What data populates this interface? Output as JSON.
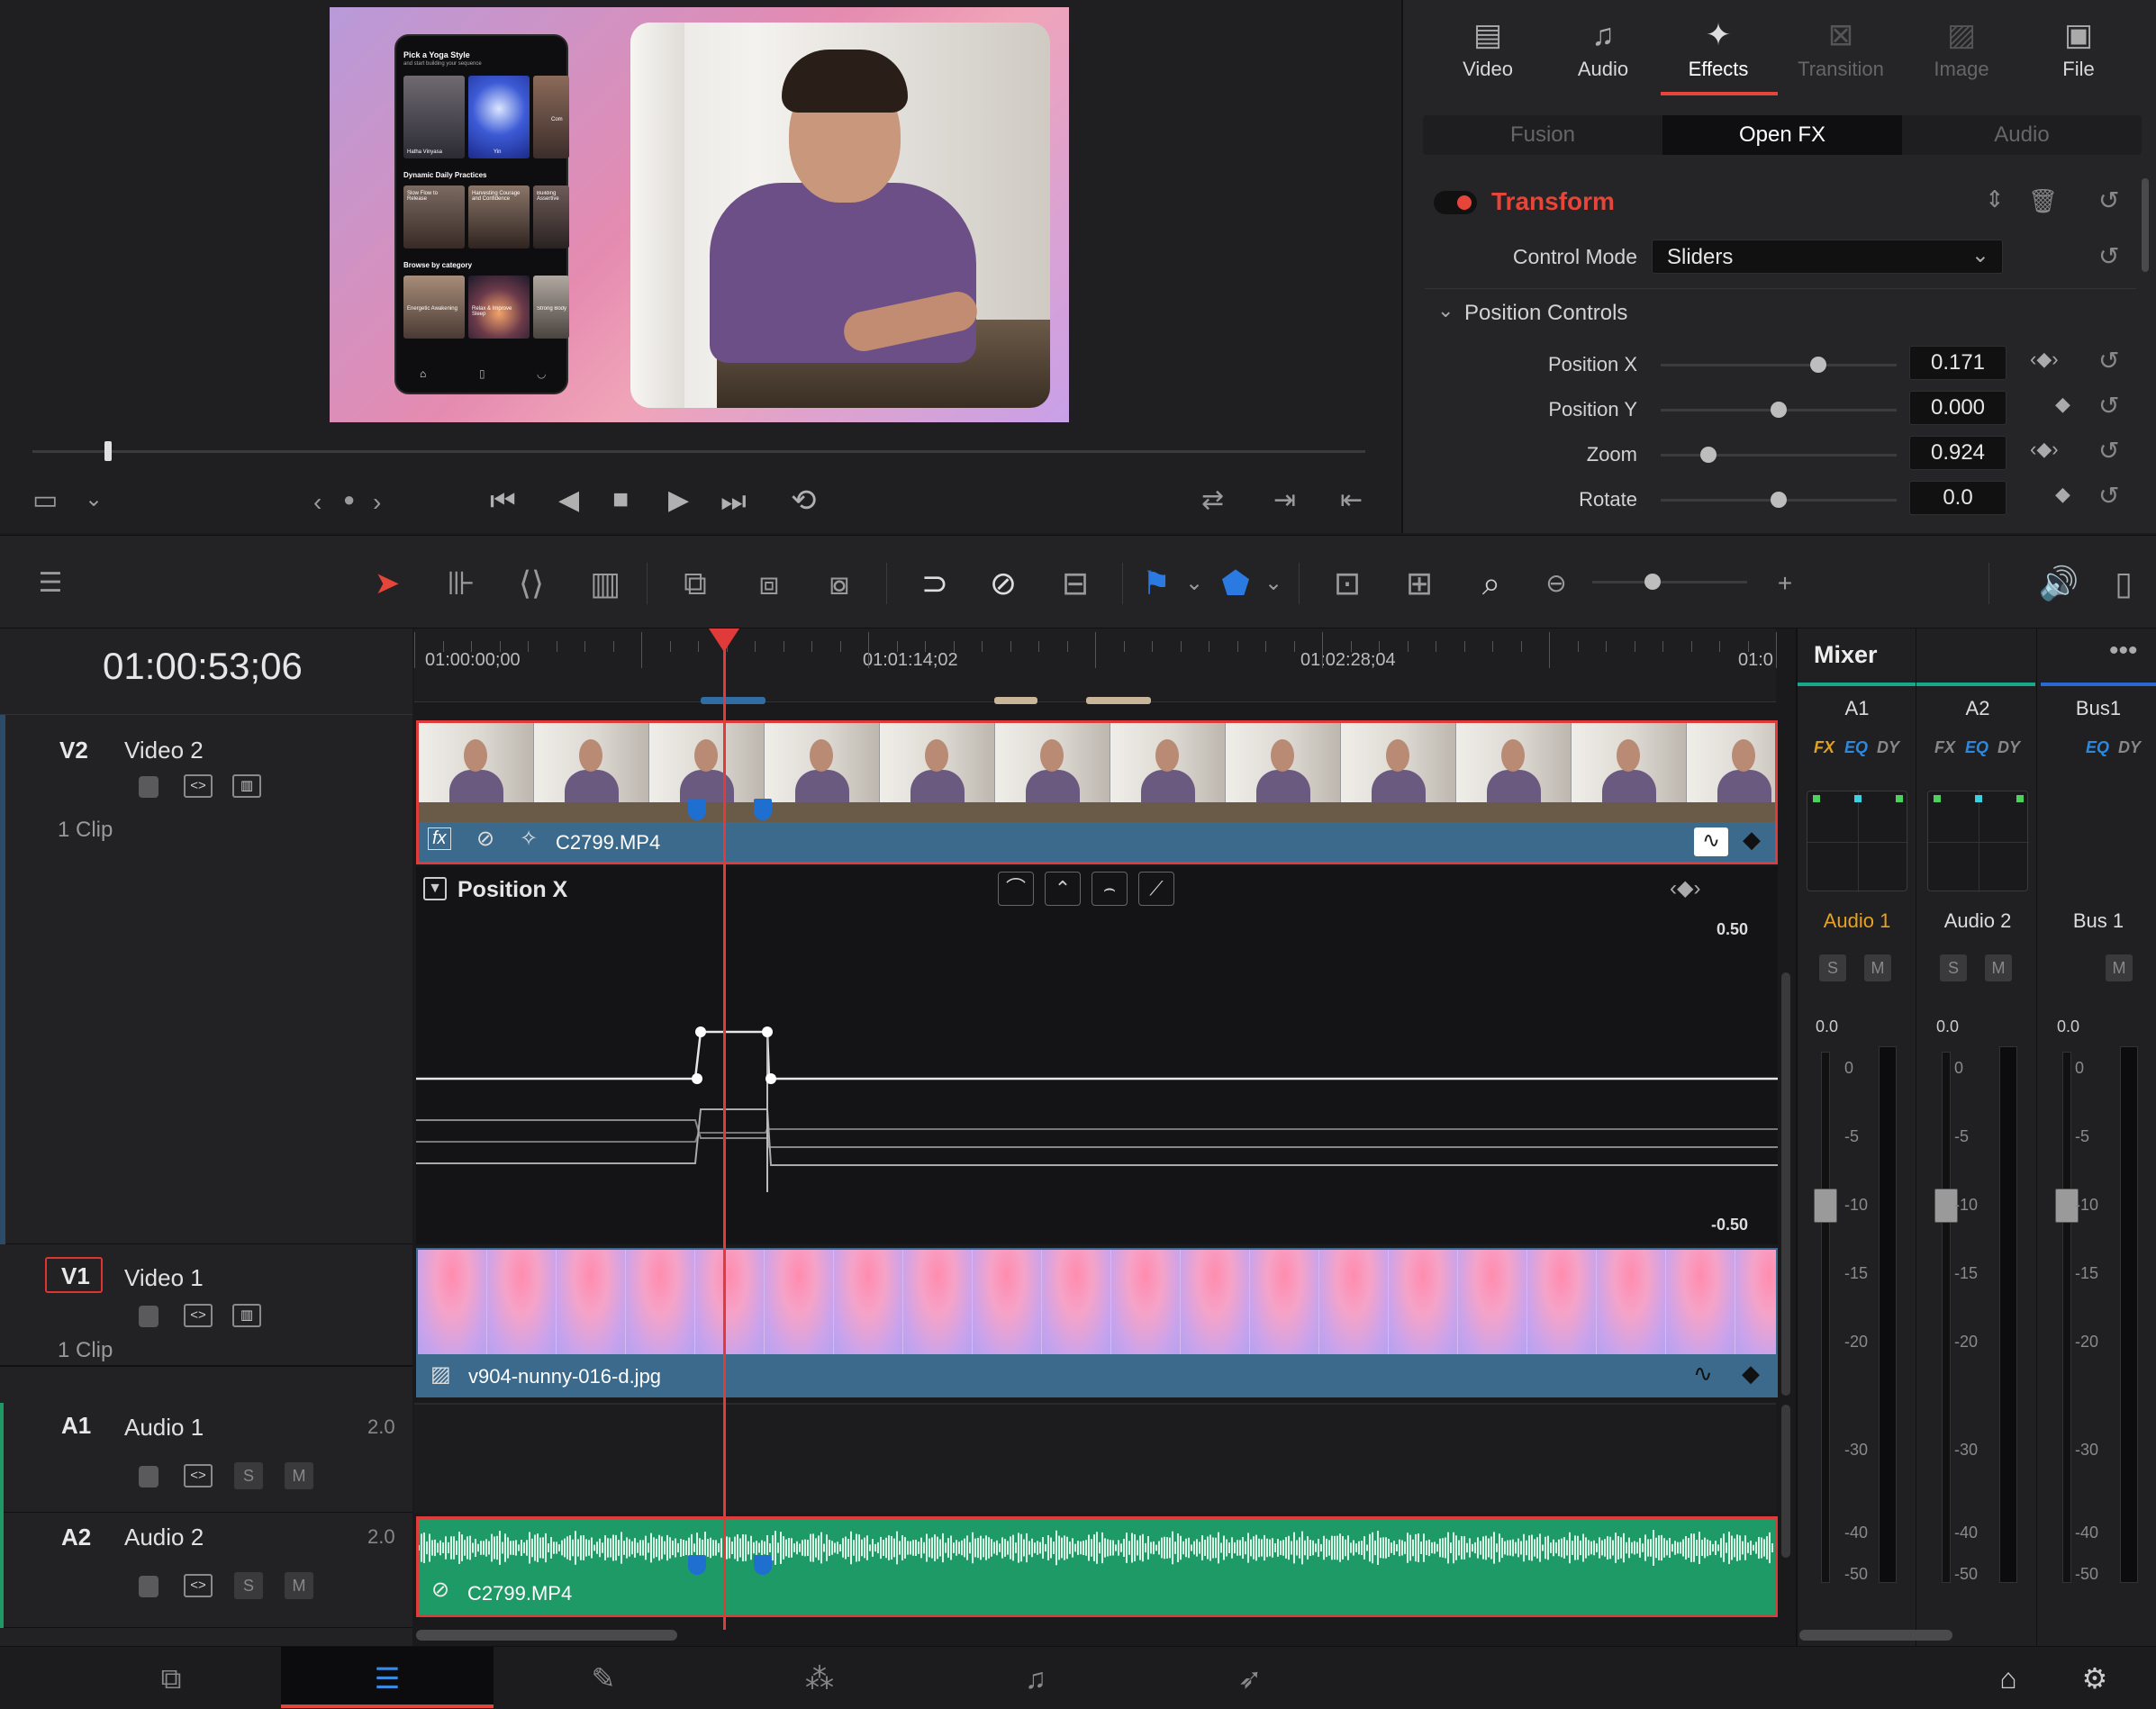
{
  "inspector": {
    "tabs": [
      {
        "label": "Video",
        "icon": "film-icon",
        "state": "normal"
      },
      {
        "label": "Audio",
        "icon": "music-note-icon",
        "state": "normal"
      },
      {
        "label": "Effects",
        "icon": "magic-wand-icon",
        "state": "active"
      },
      {
        "label": "Transition",
        "icon": "transition-icon",
        "state": "disabled"
      },
      {
        "label": "Image",
        "icon": "image-icon",
        "state": "disabled"
      },
      {
        "label": "File",
        "icon": "file-icon",
        "state": "normal"
      }
    ],
    "subtabs": [
      "Fusion",
      "Open FX",
      "Audio"
    ],
    "section_title": "Transform",
    "control_mode_label": "Control Mode",
    "control_mode_value": "Sliders",
    "group_title": "Position Controls",
    "params": [
      {
        "label": "Position X",
        "value": "0.171",
        "slider": 0.68
      },
      {
        "label": "Position Y",
        "value": "0.000",
        "slider": 0.5
      },
      {
        "label": "Zoom",
        "value": "0.924",
        "slider": 0.18
      },
      {
        "label": "Rotate",
        "value": "0.0",
        "slider": 0.5
      }
    ]
  },
  "preview": {
    "phone": {
      "heading": "Pick a Yoga Style",
      "subheading": "and start building your sequence",
      "style_captions": [
        "Hatha Vinyasa",
        "Yin",
        "Com"
      ],
      "section1": "Dynamic Daily Practices",
      "practice_captions": [
        "Slow Flow to Release",
        "Harvesting Courage and Confidence",
        "Building Assertive"
      ],
      "section2": "Browse by category",
      "category_captions": [
        "Energetic Awakening",
        "Relax & Improve Sleep",
        "Strong Body"
      ]
    }
  },
  "timeline": {
    "timecode": "01:00:53;06",
    "ruler_labels": [
      "01:00:00;00",
      "01:01:14;02",
      "01:02:28;04",
      "01:0"
    ],
    "playhead_fraction": 0.227,
    "tracks": {
      "v2": {
        "id": "V2",
        "name": "Video 2",
        "clips": "1 Clip",
        "clip_name": "C2799.MP4"
      },
      "v1": {
        "id": "V1",
        "name": "Video 1",
        "clips": "1 Clip",
        "clip_name": "v904-nunny-016-d.jpg"
      },
      "a1": {
        "id": "A1",
        "name": "Audio 1",
        "channels": "2.0"
      },
      "a2": {
        "id": "A2",
        "name": "Audio 2",
        "channels": "2.0",
        "clip_name": "C2799.MP4"
      }
    },
    "keyframe_editor": {
      "param": "Position X",
      "max": "0.50",
      "min": "-0.50"
    },
    "solo": "S",
    "mute": "M"
  },
  "mixer": {
    "title": "Mixer",
    "channels": [
      {
        "id": "A1",
        "fx": "FX",
        "eq": "EQ",
        "dy": "DY",
        "name": "Audio 1",
        "level": "0.0",
        "active": true
      },
      {
        "id": "A2",
        "fx": "FX",
        "eq": "EQ",
        "dy": "DY",
        "name": "Audio 2",
        "level": "0.0",
        "active": false
      },
      {
        "id": "Bus1",
        "fx": "",
        "eq": "EQ",
        "dy": "DY",
        "name": "Bus 1",
        "level": "0.0",
        "active": false
      }
    ],
    "scale": [
      "0",
      "-5",
      "-10",
      "-15",
      "-20",
      "-30",
      "-40",
      "-50"
    ]
  },
  "colors": {
    "accent": "#e64539",
    "clip_blue": "#3b6a8c",
    "audio_green": "#1d9a66",
    "selection_red": "#e03a3a",
    "mixer_teal": "#1aa88a",
    "mixer_blue": "#2a6ad0"
  }
}
